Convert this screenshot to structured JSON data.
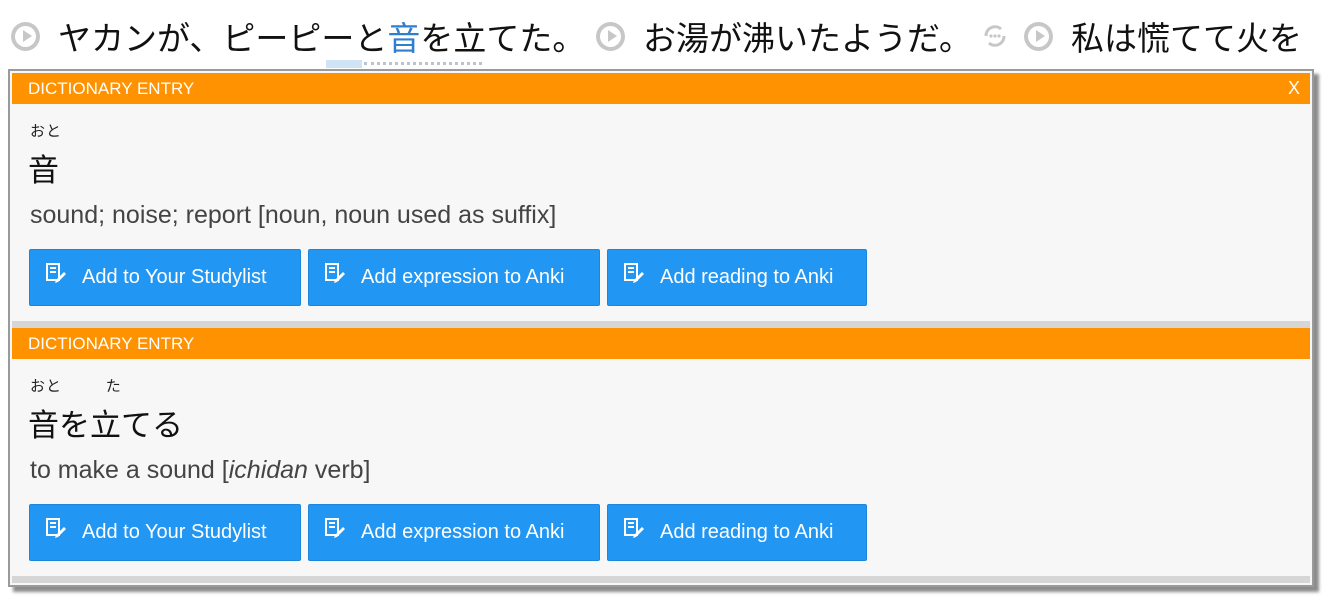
{
  "sentences": [
    {
      "prefix": "ヤカンが、ピーピーと",
      "highlight": "音",
      "suffix": "を立てた。"
    },
    {
      "prefix": "お湯が沸いたようだ。",
      "highlight": "",
      "suffix": ""
    },
    {
      "prefix": "私は慌てて火を",
      "highlight": "",
      "suffix": ""
    }
  ],
  "icons": {
    "play": "play-circle-icon",
    "loop": "repeat-icon",
    "edit": "edit-note-icon",
    "close": "close-icon"
  },
  "colors": {
    "header": "#ff9200",
    "button": "#2196f3",
    "highlight_text": "#2f7fd0"
  },
  "entries": [
    {
      "header": "DICTIONARY ENTRY",
      "close": "X",
      "reading": "おと",
      "headword": "音",
      "definition_main": "sound; noise; report [noun, noun used as suffix]",
      "buttons": {
        "studylist": "Add to Your Studylist",
        "expression": "Add expression to Anki",
        "reading": "Add reading to Anki"
      }
    },
    {
      "header": "DICTIONARY ENTRY",
      "reading_parts": [
        "おと",
        "た"
      ],
      "headword": "音を立てる",
      "definition_pre": "to make a sound [",
      "definition_italic": "ichidan",
      "definition_post": " verb]",
      "buttons": {
        "studylist": "Add to Your Studylist",
        "expression": "Add expression to Anki",
        "reading": "Add reading to Anki"
      }
    }
  ]
}
